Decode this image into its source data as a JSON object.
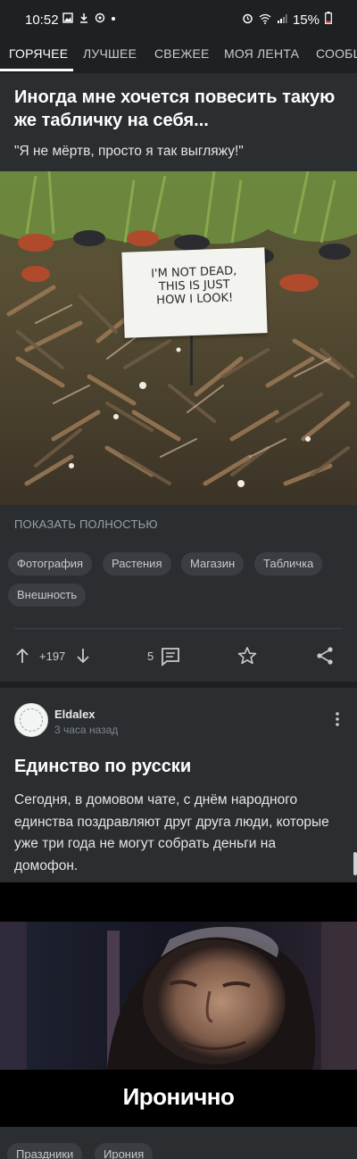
{
  "status_bar": {
    "time": "10:52",
    "battery": "15%"
  },
  "tabs": [
    {
      "label": "ГОРЯЧЕЕ",
      "active": true
    },
    {
      "label": "ЛУЧШЕЕ",
      "active": false
    },
    {
      "label": "СВЕЖЕЕ",
      "active": false
    },
    {
      "label": "МОЯ ЛЕНТА",
      "active": false
    },
    {
      "label": "СООБЩ",
      "active": false
    }
  ],
  "post1": {
    "title": "Иногда мне хочется повесить такую же табличку на себя...",
    "text": "\"Я не мёртв, просто я так выгляжу!\"",
    "image_sign_text": [
      "I'M NOT DEAD,",
      "THIS IS JUST",
      "HOW I LOOK!"
    ],
    "show_full": "ПОКАЗАТЬ ПОЛНОСТЬЮ",
    "tags": [
      "Фотография",
      "Растения",
      "Магазин",
      "Табличка",
      "Внешность"
    ],
    "rating": "+197",
    "comments": "5"
  },
  "post2": {
    "author": "Eldalex",
    "time": "3 часа назад",
    "title": "Единство по русски",
    "text": "Сегодня, в домовом чате, с днём народного единства поздравляют друг друга люди, которые уже три года не могут собрать деньги на домофон.",
    "image_caption": "Иронично",
    "tags": [
      "Праздники",
      "Ирония"
    ]
  },
  "colors": {
    "background": "#1e2124",
    "card": "#2b2e31",
    "tag_bg": "#3a3d41",
    "accent_text": "#ffffff"
  }
}
